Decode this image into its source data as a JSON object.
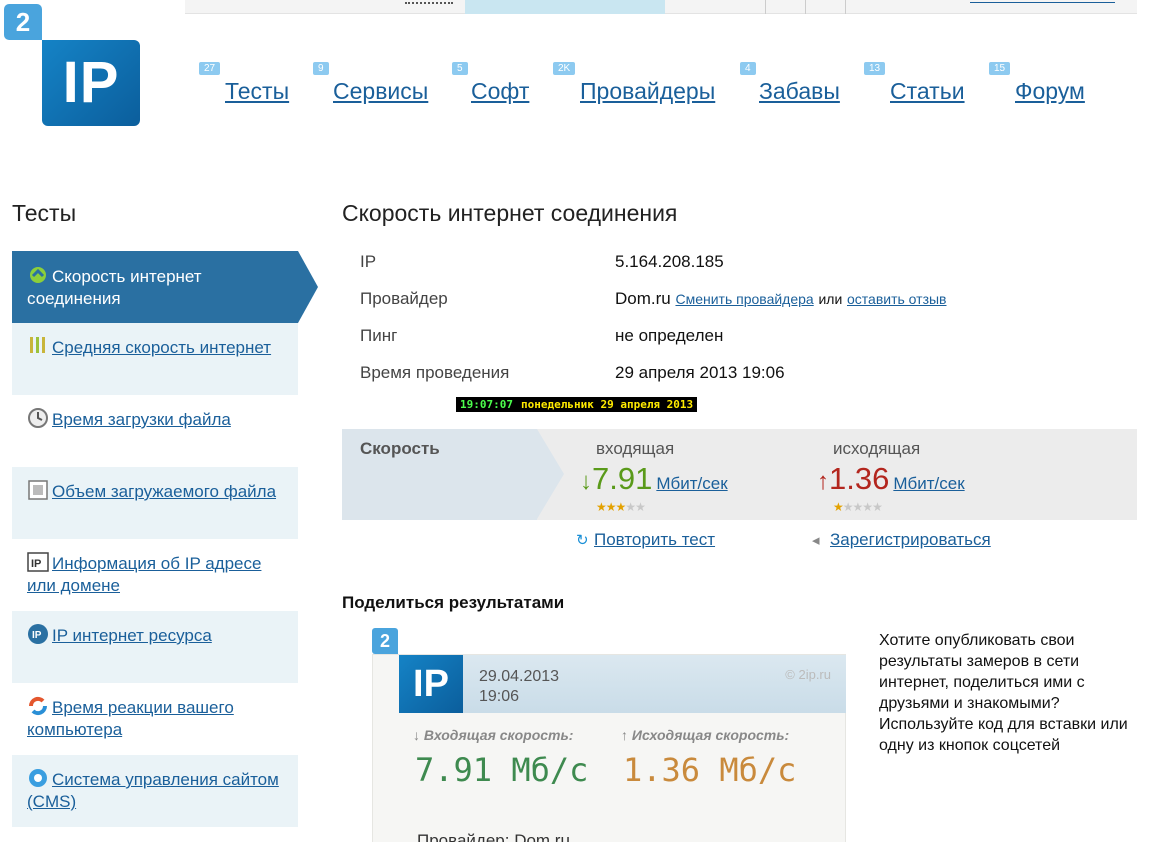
{
  "logo": {
    "badge": "2",
    "text": "IP"
  },
  "nav": [
    {
      "count": "27",
      "label": "Тесты"
    },
    {
      "count": "9",
      "label": "Сервисы"
    },
    {
      "count": "5",
      "label": "Софт"
    },
    {
      "count": "2K",
      "label": "Провайдеры"
    },
    {
      "count": "4",
      "label": "Забавы"
    },
    {
      "count": "13",
      "label": "Статьи"
    },
    {
      "count": "15",
      "label": "Форум"
    }
  ],
  "sidebar": {
    "title": "Тесты",
    "items": [
      {
        "label": "Скорость интернет соединения",
        "icon": "speed-icon"
      },
      {
        "label": "Средняя скорость интернет",
        "icon": "bars-icon"
      },
      {
        "label": "Время загрузки файла",
        "icon": "clock-icon"
      },
      {
        "label": "Объем загружаемого файла",
        "icon": "square-icon"
      },
      {
        "label": "Информация об IP адресе или домене",
        "icon": "ip-icon"
      },
      {
        "label": "IP интернет ресурса",
        "icon": "ip-globe-icon"
      },
      {
        "label": "Время реакции вашего компьютера",
        "icon": "refresh-icon"
      },
      {
        "label": "Система управления сайтом (CMS)",
        "icon": "gear-icon"
      }
    ]
  },
  "main": {
    "title": "Скорость интернет соединения",
    "info": {
      "ip_label": "IP",
      "ip_value": "5.164.208.185",
      "provider_label": "Провайдер",
      "provider_value": "Dom.ru",
      "change_provider": "Сменить провайдера",
      "or": "или",
      "leave_review": "оставить отзыв",
      "ping_label": "Пинг",
      "ping_value": "не определен",
      "time_label": "Время проведения",
      "time_value": "29 апреля 2013 19:06"
    },
    "clock": {
      "time": "19:07:07",
      "date": "понедельник 29 апреля 2013"
    },
    "speed": {
      "label": "Скорость",
      "incoming_label": "входящая",
      "incoming_arrow": "↓",
      "incoming_value": "7.91",
      "incoming_rating": 2.5,
      "outgoing_label": "исходящая",
      "outgoing_arrow": "↑",
      "outgoing_value": "1.36",
      "outgoing_rating": 1,
      "unit": "Мбит/сек",
      "colors": {
        "incoming": "#5a9a1a",
        "outgoing": "#b3261e"
      }
    },
    "actions": {
      "repeat": "Повторить тест",
      "register": "Зарегистрироваться"
    }
  },
  "share": {
    "title": "Поделиться результатами",
    "card": {
      "badge": "2",
      "logo_text": "IP",
      "date": "29.04.2013",
      "time": "19:06",
      "site": "© 2ip.ru",
      "in_label": "↓ Входящая скорость:",
      "in_value": "7.91 Мб/с",
      "out_label": "↑ Исходящая скорость:",
      "out_value": "1.36 Мб/с",
      "provider": "Провайдер: Dom.ru"
    },
    "text": "Хотите опубликовать свои результаты замеров в сети интернет, поделиться ими с друзьями и знакомыми? Используйте код для вставки или одну из кнопок соцсетей"
  },
  "colors": {
    "accent": "#2a70a2",
    "link": "#1a5f9a",
    "logo": "#1583c6"
  }
}
